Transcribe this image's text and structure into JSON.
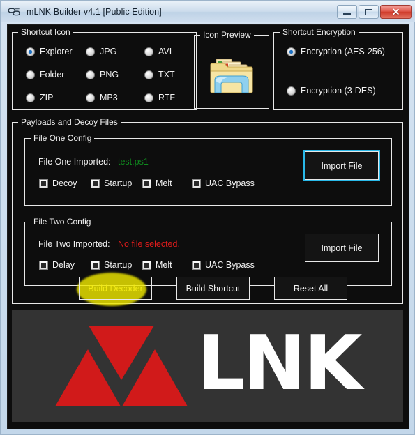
{
  "window": {
    "title": "mLNK Builder v4.1 [Public Edition]",
    "icon": "chain-link-icon",
    "controls": {
      "minimize": "–",
      "maximize": "□",
      "close": "✕"
    }
  },
  "shortcut_icon": {
    "legend": "Shortcut Icon",
    "options": [
      {
        "label": "Explorer",
        "selected": true
      },
      {
        "label": "JPG",
        "selected": false
      },
      {
        "label": "AVI",
        "selected": false
      },
      {
        "label": "Folder",
        "selected": false
      },
      {
        "label": "PNG",
        "selected": false
      },
      {
        "label": "TXT",
        "selected": false
      },
      {
        "label": "ZIP",
        "selected": false
      },
      {
        "label": "MP3",
        "selected": false
      },
      {
        "label": "RTF",
        "selected": false
      }
    ]
  },
  "icon_preview": {
    "legend": "Icon Preview",
    "image": "windows-explorer-folder-icon"
  },
  "encryption": {
    "legend": "Shortcut Encryption",
    "options": [
      {
        "label": "Encryption (AES-256)",
        "selected": true
      },
      {
        "label": "Encryption (3-DES)",
        "selected": false
      }
    ]
  },
  "payloads": {
    "legend": "Payloads and Decoy Files",
    "file_one": {
      "legend": "File One Config",
      "imported_label": "File One Imported:",
      "imported_value": "test.ps1",
      "imported_value_color": "#0f8a1e",
      "import_button": "Import File",
      "import_button_focused": true,
      "checkboxes": [
        {
          "label": "Decoy",
          "checked": false
        },
        {
          "label": "Startup",
          "checked": false
        },
        {
          "label": "Melt",
          "checked": false
        },
        {
          "label": "UAC Bypass",
          "checked": false
        }
      ]
    },
    "file_two": {
      "legend": "File Two Config",
      "imported_label": "File Two Imported:",
      "imported_value": "No file selected.",
      "imported_value_color": "#e01b1b",
      "import_button": "Import File",
      "import_button_focused": false,
      "checkboxes": [
        {
          "label": "Delay",
          "checked": false
        },
        {
          "label": "Startup",
          "checked": false
        },
        {
          "label": "Melt",
          "checked": false
        },
        {
          "label": "UAC Bypass",
          "checked": false
        }
      ]
    }
  },
  "actions": {
    "build_decoder": "Build Decoder",
    "build_shortcut": "Build Shortcut",
    "reset_all": "Reset All",
    "highlighted": "Build Decoder",
    "highlight_color": "#efe800"
  },
  "branding": {
    "wordmark": "LNK",
    "mark": "triple-triangle-m-logo",
    "red": "#d11a1a",
    "background": "#333333"
  }
}
